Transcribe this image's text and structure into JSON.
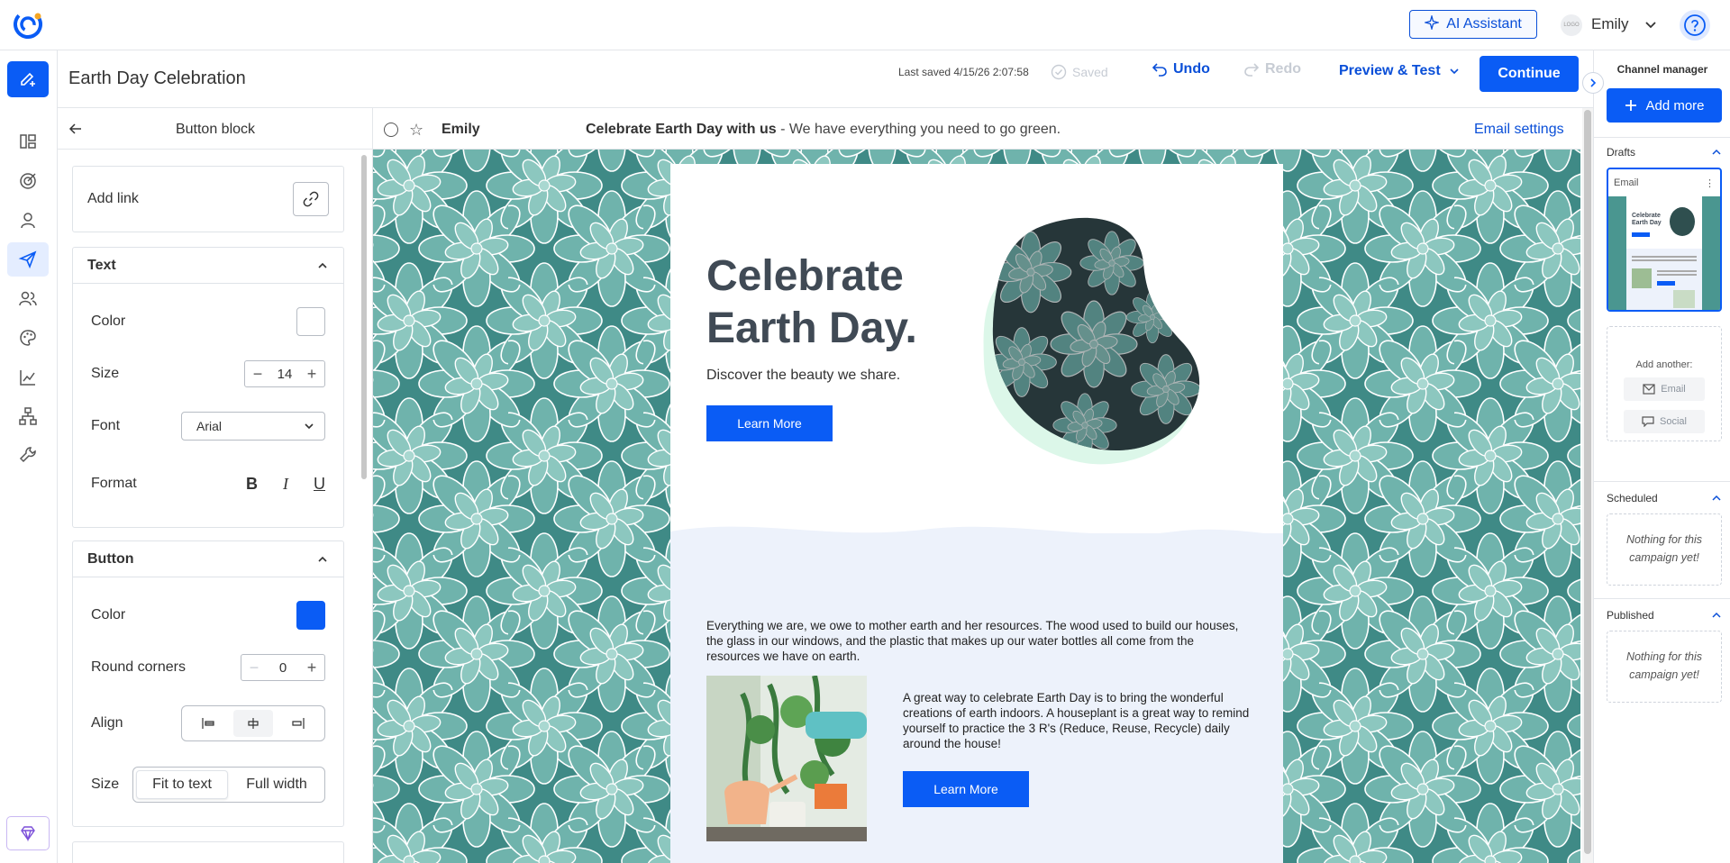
{
  "topbar": {
    "ai_assistant": "AI Assistant",
    "user_logo": "LOGO",
    "user_name": "Emily"
  },
  "titlebar": {
    "campaign_title": "Earth Day Celebration",
    "last_saved_label": "Last saved 4/15/26 2:07:58",
    "saved_label": "Saved",
    "undo_label": "Undo",
    "redo_label": "Redo",
    "preview_label": "Preview & Test",
    "continue_label": "Continue"
  },
  "rail": {
    "items": [
      "layout-icon",
      "target-icon",
      "contact-icon",
      "send-icon",
      "people-icon",
      "palette-icon",
      "chart-icon",
      "hierarchy-icon",
      "wrench-icon"
    ],
    "active_index": 3
  },
  "panel": {
    "title": "Button block",
    "add_link_label": "Add link",
    "text_section": {
      "title": "Text",
      "color_label": "Color",
      "color_value": "#ffffff",
      "size_label": "Size",
      "size_value": "14",
      "font_label": "Font",
      "font_value": "Arial",
      "format_label": "Format",
      "format_bold": "B",
      "format_italic": "I",
      "format_underline": "U"
    },
    "button_section": {
      "title": "Button",
      "color_label": "Color",
      "color_value": "#0a5cf5",
      "round_corners_label": "Round corners",
      "round_corners_value": "0",
      "align_label": "Align",
      "align_selected": "center",
      "size_label": "Size",
      "size_options": [
        "Fit to text",
        "Full width"
      ],
      "size_selected": "Fit to text"
    }
  },
  "email_header": {
    "from": "Emily",
    "subject": "Celebrate Earth Day with us",
    "preheader": " - We have everything you need to go green.",
    "settings_link": "Email settings"
  },
  "email": {
    "hero_title": "Celebrate Earth Day.",
    "hero_subtitle": "Discover the beauty we share.",
    "hero_button": "Learn More",
    "paragraph_1": "Everything we are, we owe to mother earth and her resources. The wood used to build our houses, the glass in our windows, and the plastic that makes up our water bottles all come from the resources we have on earth.",
    "paragraph_2": "A great way to celebrate Earth Day is to bring the wonderful creations of earth indoors. A houseplant is a great way to remind yourself to practice the 3 R's (Reduce, Reuse, Recycle) daily around the house!",
    "second_button": "Learn More",
    "accent_color": "#0a5cf5"
  },
  "channel_manager": {
    "title": "Channel manager",
    "add_more": "Add more",
    "drafts_label": "Drafts",
    "draft_item_label": "Email",
    "thumb_title": "Celebrate Earth Day",
    "add_another_label": "Add another:",
    "add_email": "Email",
    "add_social": "Social",
    "scheduled_label": "Scheduled",
    "scheduled_empty": "Nothing for this campaign yet!",
    "published_label": "Published",
    "published_empty": "Nothing for this campaign yet!"
  }
}
